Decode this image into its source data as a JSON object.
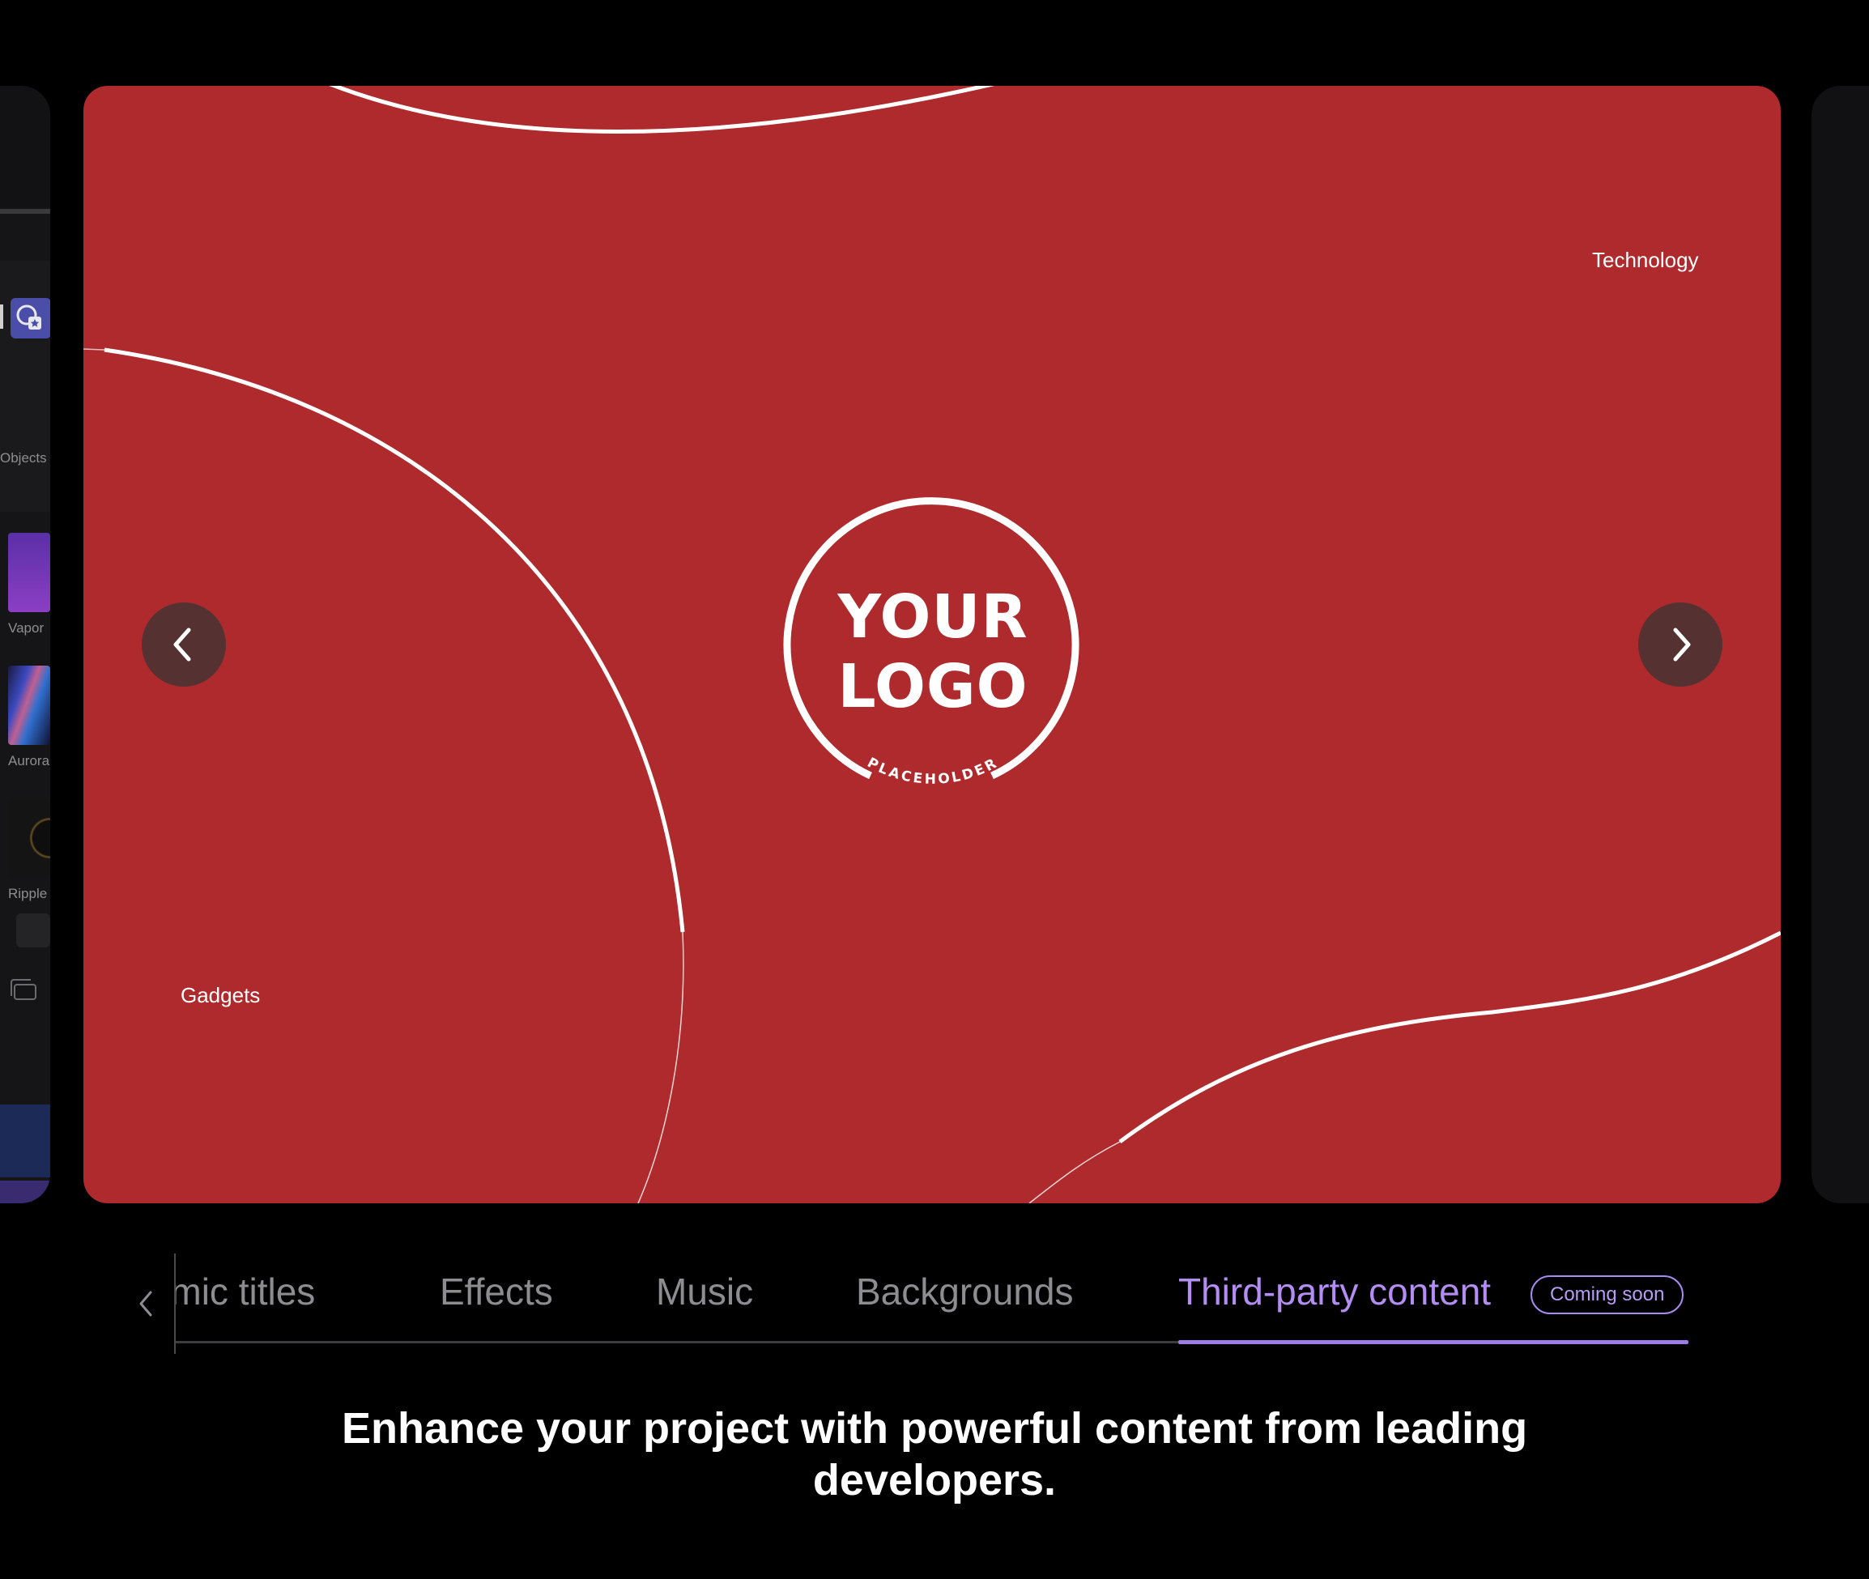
{
  "left_preview": {
    "labels": [
      "Objects",
      "Vapor",
      "Aurora",
      "Ripple"
    ]
  },
  "slide": {
    "background_color": "#ae2a2c",
    "label_top_right": "Technology",
    "label_bottom_left": "Gadgets",
    "logo": {
      "text_line1": "YOUR",
      "text_line2": "LOGO",
      "caption": "PLACEHOLDER"
    },
    "prev_icon": "chevron-left-icon",
    "next_icon": "chevron-right-icon"
  },
  "tabs": {
    "scroll_icon": "chevron-left-icon",
    "items": [
      {
        "label": "Dynamic titles",
        "state": "partially-hidden"
      },
      {
        "label": "Effects",
        "state": "inactive"
      },
      {
        "label": "Music",
        "state": "inactive"
      },
      {
        "label": "Backgrounds",
        "state": "inactive"
      },
      {
        "label": "Third-party content",
        "state": "active"
      }
    ],
    "badge": "Coming soon",
    "inactive_color": "#8c8c91",
    "active_color": "#b38df2"
  },
  "description": "Enhance your project with powerful content from leading developers."
}
